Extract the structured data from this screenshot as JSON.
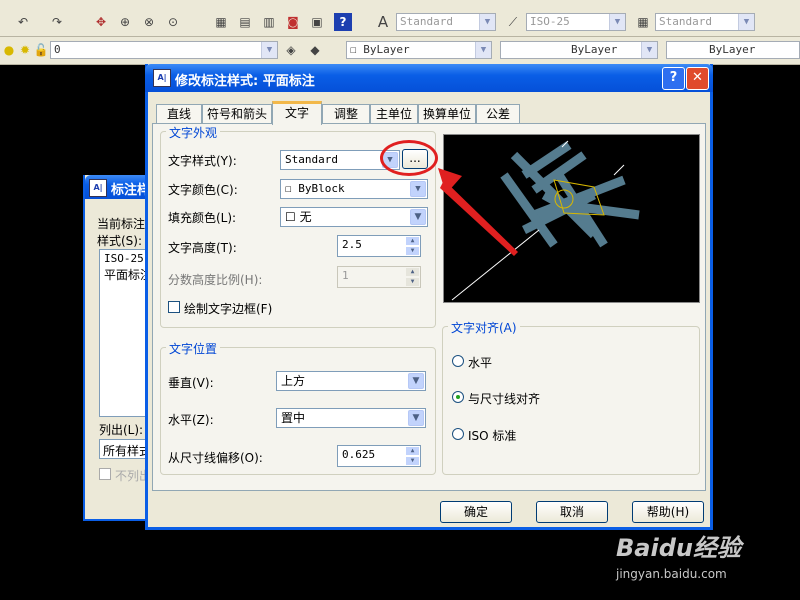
{
  "toolbar1": {
    "text_style_combo": "Standard",
    "dim_style_combo": "ISO-25",
    "table_style_combo": "Standard"
  },
  "toolbar2": {
    "layer_combo": "0",
    "color_combo": "ByLayer",
    "linetype_combo": "ByLayer",
    "lineweight_combo": "ByLayer"
  },
  "back_dialog": {
    "title": "标注样",
    "current_label": "当前标注",
    "styles_label": "样式(S):",
    "styles": [
      "ISO-25",
      "平面标注"
    ],
    "list_label": "列出(L):",
    "list_value": "所有样式",
    "no_list_label": "不列出"
  },
  "dialog": {
    "title": "修改标注样式: 平面标注",
    "help_icon": "?",
    "tabs": [
      "直线",
      "符号和箭头",
      "文字",
      "调整",
      "主单位",
      "换算单位",
      "公差"
    ],
    "active_tab": "文字",
    "appearance": {
      "title": "文字外观",
      "style_label": "文字样式(Y):",
      "style_value": "Standard",
      "browse_button": "...",
      "color_label": "文字颜色(C):",
      "color_value": "ByBlock",
      "fill_label": "填充颜色(L):",
      "fill_value": "无",
      "height_label": "文字高度(T):",
      "height_value": "2.5",
      "fraction_label": "分数高度比例(H):",
      "fraction_value": "1",
      "frame_label": "绘制文字边框(F)"
    },
    "placement": {
      "title": "文字位置",
      "vertical_label": "垂直(V):",
      "vertical_value": "上方",
      "horizontal_label": "水平(Z):",
      "horizontal_value": "置中",
      "offset_label": "从尺寸线偏移(O):",
      "offset_value": "0.625"
    },
    "alignment": {
      "title": "文字对齐(A)",
      "options": [
        "水平",
        "与尺寸线对齐",
        "ISO 标准"
      ],
      "selected": "与尺寸线对齐"
    },
    "buttons": {
      "ok": "确定",
      "cancel": "取消",
      "help": "帮助(H)"
    }
  },
  "watermark": {
    "brand": "Baidu经验",
    "url": "jingyan.baidu.com"
  },
  "colors": {
    "highlight_circle": "#e02020",
    "arrow": "#e02020",
    "preview_bg": "#000000",
    "dim_lines": "#557c8f"
  }
}
